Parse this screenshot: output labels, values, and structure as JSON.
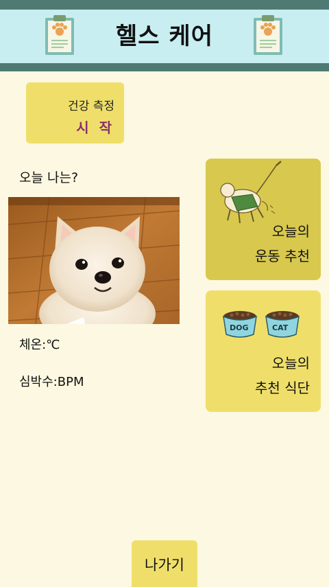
{
  "header": {
    "title": "헬스 케어",
    "left_icon": "paw-clipboard-icon",
    "right_icon": "paw-clipboard-icon"
  },
  "measure": {
    "line1": "건강 측정",
    "line2": "시 작"
  },
  "status": {
    "heading": "오늘 나는?",
    "temperature": "체온:℃",
    "heart_rate": "심박수:BPM"
  },
  "exercise_card": {
    "line1": "오늘의",
    "line2": "운동 추천",
    "icon": "dog-walking-icon"
  },
  "diet_card": {
    "line1": "오늘의",
    "line2": "추천 식단",
    "icon": "pet-food-bowls-icon",
    "bowl_left": "DOG",
    "bowl_right": "CAT"
  },
  "footer": {
    "exit_label": "나가기"
  },
  "colors": {
    "background": "#fdf8e1",
    "header_band": "#c9eef2",
    "header_border": "#4f7a74",
    "button_yellow": "#efdf6a",
    "card_olive": "#d8c84e",
    "accent_purple": "#8a2e6a"
  }
}
